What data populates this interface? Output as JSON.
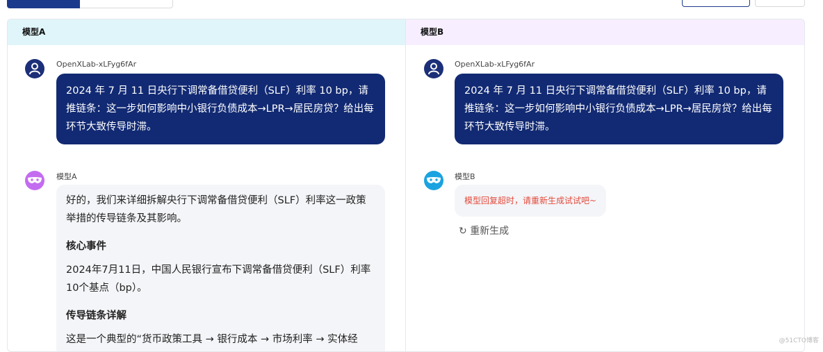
{
  "panels": {
    "a": {
      "title": "模型A",
      "user_name": "OpenXLab-xLFyg6fAr",
      "user_message": "2024 年 7 月 11 日央行下调常备借贷便利（SLF）利率 10 bp，请推链条：这一步如何影响中小银行负债成本→LPR→居民房贷？给出每环节大致传导时滞。",
      "model_name": "模型A",
      "reply": {
        "intro": "好的，我们来详细拆解央行下调常备借贷便利（SLF）利率这一政策举措的传导链条及其影响。",
        "section1_title": "核心事件",
        "section1_text": "2024年7月11日，中国人民银行宣布下调常备借贷便利（SLF）利率10个基点（bp）。",
        "section2_title": "传导链条详解",
        "section2_text": "这是一个典型的“货币政策工具 → 银行成本 → 市场利率 → 实体经"
      }
    },
    "b": {
      "title": "模型B",
      "user_name": "OpenXLab-xLFyg6fAr",
      "user_message": "2024 年 7 月 11 日央行下调常备借贷便利（SLF）利率 10 bp，请推链条：这一步如何影响中小银行负债成本→LPR→居民房贷？给出每环节大致传导时滞。",
      "model_name": "模型B",
      "error_text": "模型回复超时，请重新生成试试吧~",
      "regenerate_label": "重新生成"
    }
  },
  "icons": {
    "user_avatar": "user-icon",
    "model_avatar": "mask-icon",
    "regenerate": "refresh-icon"
  },
  "colors": {
    "user_bubble": "#122a73",
    "panel_a_header": "#e0f5fa",
    "panel_b_header": "#f7efff",
    "error": "#e34a3c"
  },
  "watermark": "@51CTO博客"
}
